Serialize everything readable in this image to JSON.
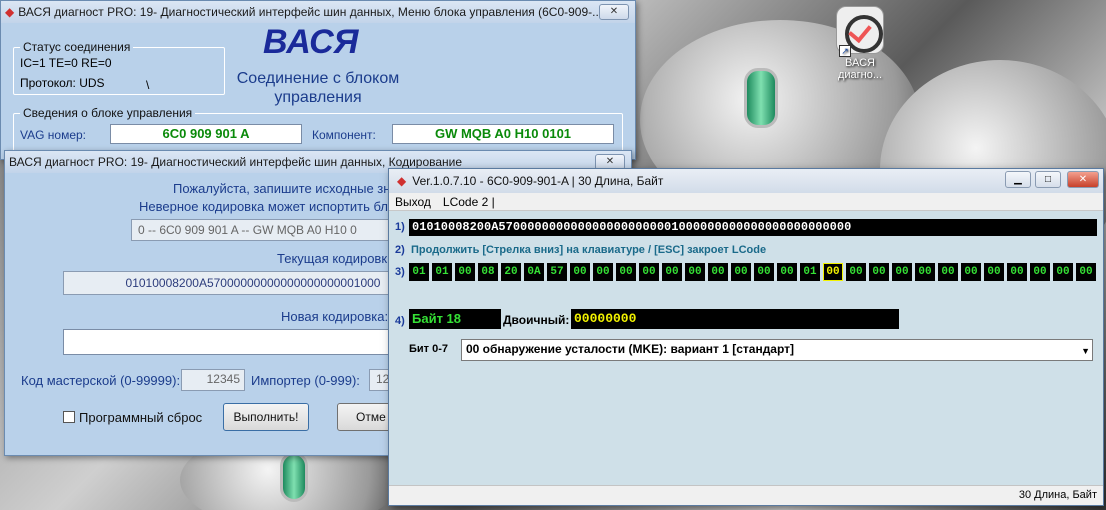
{
  "desktop": {
    "icon_label": "ВАСЯ диагно..."
  },
  "main_window": {
    "title": "ВАСЯ диагност PRO: 19- Диагностический интерфейс шин данных,  Меню блока управления (6C0-909-...",
    "close": "✕",
    "status": {
      "title": "Статус соединения",
      "line1": "IC=1  TE=0   RE=0",
      "line2": "Протокол: UDS",
      "spinner": "\\"
    },
    "logo": "ВАСЯ",
    "connection": "Соединение с блоком управления",
    "info": {
      "title": "Сведения о блоке управления",
      "vag_label": "VAG номер:",
      "vag_value": "6C0 909 901 A",
      "component_label": "Компонент:",
      "component_value": "GW MQB A0     H10 0101"
    }
  },
  "coding_window": {
    "title": "ВАСЯ диагност PRO: 19- Диагностический интерфейс шин данных,  Кодирование",
    "close": "✕",
    "notice1": "Пожалуйста, запишите исходные значения, прежд",
    "notice2": "Неверное кодировка может испортить бло",
    "module_select": "0 -- 6C0 909 901 A -- GW MQB A0     H10 0",
    "current_label": "Текущая кодировк",
    "current_value": "01010008200A57000000000000000000001000",
    "new_label": "Новая кодировка:",
    "workshop_label": "Код мастерской (0-99999):",
    "workshop_value": "12345",
    "importer_label": "Импортер (0-999):",
    "importer_value": "12",
    "reset_label": "Программный сброс",
    "execute_label": "Выполнить!",
    "cancel_label": "Отме"
  },
  "lcode_window": {
    "title": "Ver.1.0.7.10 -    6C0-909-901-A | 30 Длина, Байт",
    "minimize": "▁",
    "maximize": "□",
    "close": "✕",
    "menu": [
      "Выход",
      "LCode 2 |"
    ],
    "row1_num": "1)",
    "coding_string": "01010008200A5700000000000000000000001000000000000000000000000",
    "row2_num": "2)",
    "hint": "Продолжить [Стрелка вниз] на клавиатуре / [ESC] закроет LCode",
    "row3_num": "3)",
    "bytes": [
      "01",
      "01",
      "00",
      "08",
      "20",
      "0A",
      "57",
      "00",
      "00",
      "00",
      "00",
      "00",
      "00",
      "00",
      "00",
      "00",
      "00",
      "01",
      "00",
      "00",
      "00",
      "00",
      "00",
      "00",
      "00",
      "00",
      "00",
      "00",
      "00",
      "00"
    ],
    "selected_index": 18,
    "row4_num": "4)",
    "byte_label": "Байт 18",
    "binary_label": "Двоичный:",
    "binary_value": "00000000",
    "bit_label": "Бит 0-7",
    "bit_select": "00 обнаружение усталости (MKE): вариант 1 [стандарт]",
    "status": "30 Длина, Байт"
  }
}
